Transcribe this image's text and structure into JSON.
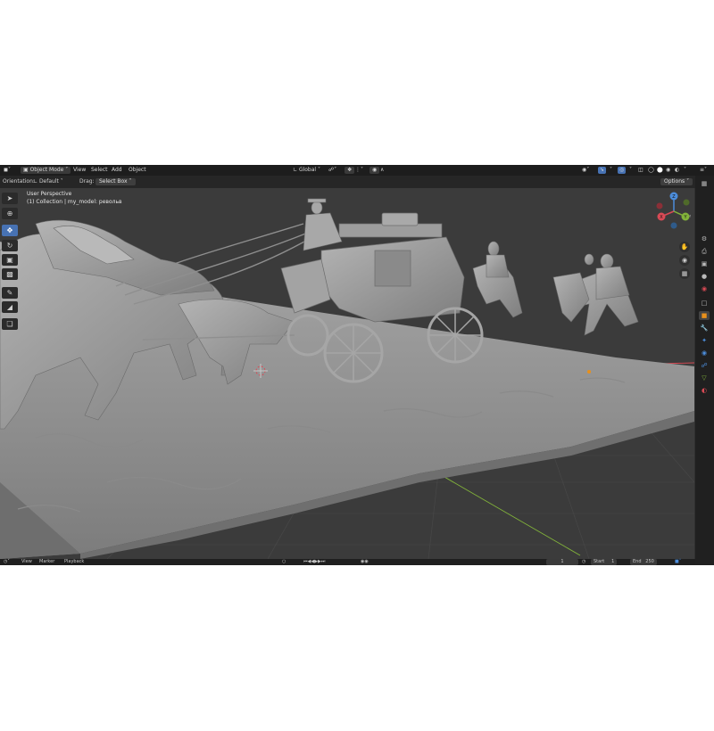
{
  "topbar": {
    "editor_icon": "cube-editor-icon",
    "mode": "Object Mode",
    "menus": [
      "View",
      "Select",
      "Add",
      "Object"
    ],
    "orientation_dropdown": "Global",
    "right_options": "viewport-shading-icons"
  },
  "toolheader": {
    "orientation_label": "Orientation:",
    "orientation_value": "Default",
    "drag_label": "Drag:",
    "drag_value": "Select Box",
    "options_label": "Options"
  },
  "viewport": {
    "perspective": "User Perspective",
    "collection": "(1) Collection | my_model: револьв",
    "gizmo_axes": [
      "X",
      "Y",
      "Z"
    ],
    "colors": {
      "x_axis": "#d94a55",
      "y_axis": "#82b33a",
      "z_axis": "#4c8ddb",
      "grid": "#464646",
      "model": "#9a9a9a"
    }
  },
  "timeline": {
    "menus": [
      "View",
      "Marker",
      "Playback"
    ],
    "current_frame": "1",
    "start_label": "Start",
    "start_value": "1",
    "end_label": "End",
    "end_value": "250"
  }
}
